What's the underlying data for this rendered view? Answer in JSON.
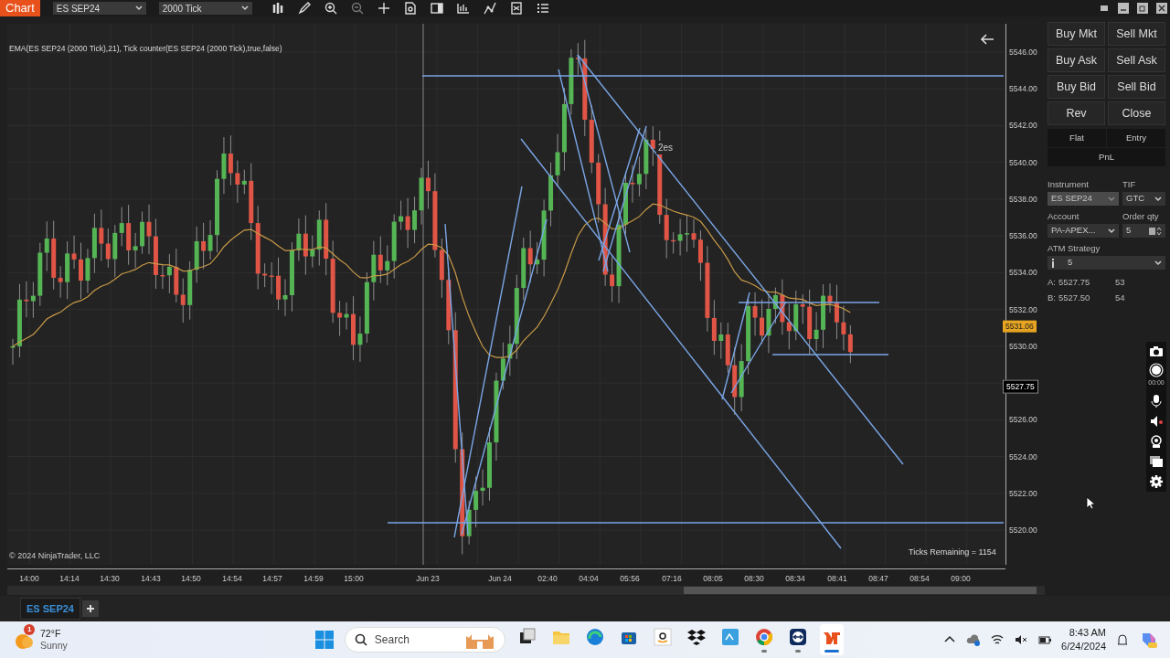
{
  "toolbar": {
    "title": "Chart",
    "instrument": "ES SEP24",
    "interval": "2000 Tick"
  },
  "chart": {
    "indicator_label": "EMA(ES SEP24 (2000 Tick),21), Tick counter(ES SEP24 (2000 Tick),true,false)",
    "annotation": "2es",
    "price_labels": [
      "5546.00",
      "5544.00",
      "5542.00",
      "5540.00",
      "5538.00",
      "5536.00",
      "5534.00",
      "5532.00",
      "5530.00",
      "5526.00",
      "5524.00",
      "5522.00",
      "5520.00"
    ],
    "last_price": "5531.06",
    "current_price": "5527.75",
    "time_labels": [
      "14:00",
      "14:14",
      "14:30",
      "14:43",
      "14:50",
      "14:54",
      "14:57",
      "14:59",
      "15:00",
      "Jun 23",
      "Jun 24",
      "02:40",
      "04:04",
      "05:56",
      "07:16",
      "08:05",
      "08:30",
      "08:34",
      "08:41",
      "08:47",
      "08:54",
      "09:00"
    ],
    "copyright": "© 2024 NinjaTrader, LLC",
    "ticks_remaining": "Ticks Remaining = 1154"
  },
  "order_panel": {
    "buttons": [
      "Buy Mkt",
      "Sell Mkt",
      "Buy Ask",
      "Sell Ask",
      "Buy Bid",
      "Sell Bid",
      "Rev",
      "Close"
    ],
    "position_tabs": [
      "Flat",
      "Entry",
      "PnL"
    ],
    "fields": [
      {
        "label": "Instrument",
        "value": "ES SEP24",
        "kind": "select",
        "disabled": true
      },
      {
        "label": "TIF",
        "value": "GTC",
        "kind": "select",
        "disabled": false
      },
      {
        "label": "Account",
        "value": "PA-APEX...",
        "kind": "select",
        "disabled": false
      },
      {
        "label": "Order qty",
        "value": "5",
        "kind": "number",
        "disabled": false
      }
    ],
    "atm_label": "ATM Strategy",
    "atm_value": "5",
    "quotes": [
      {
        "side": "A:",
        "price": "5527.75",
        "size": "53"
      },
      {
        "side": "B:",
        "price": "5527.50",
        "size": "54"
      }
    ]
  },
  "recorder": {
    "timer": "00:00"
  },
  "tabs": [
    {
      "label": "ES SEP24",
      "selected": true
    }
  ],
  "taskbar": {
    "weather": {
      "badge": "1",
      "temperature": "72°F",
      "condition": "Sunny"
    },
    "search_placeholder": "Search",
    "apps": [
      {
        "kind": "task-view",
        "running": false,
        "selected": false
      },
      {
        "kind": "files",
        "running": false,
        "selected": false
      },
      {
        "kind": "edge",
        "running": false,
        "selected": false
      },
      {
        "kind": "store",
        "running": false,
        "selected": false
      },
      {
        "kind": "amazon",
        "running": false,
        "selected": false
      },
      {
        "kind": "dropbox",
        "running": false,
        "selected": false
      },
      {
        "kind": "hp",
        "running": false,
        "selected": false
      },
      {
        "kind": "chrome",
        "running": true,
        "selected": false
      },
      {
        "kind": "teamviewer",
        "running": true,
        "selected": false
      },
      {
        "kind": "ninjatrader",
        "running": true,
        "selected": true
      }
    ],
    "time": "8:43 AM",
    "date": "6/24/2024"
  }
}
